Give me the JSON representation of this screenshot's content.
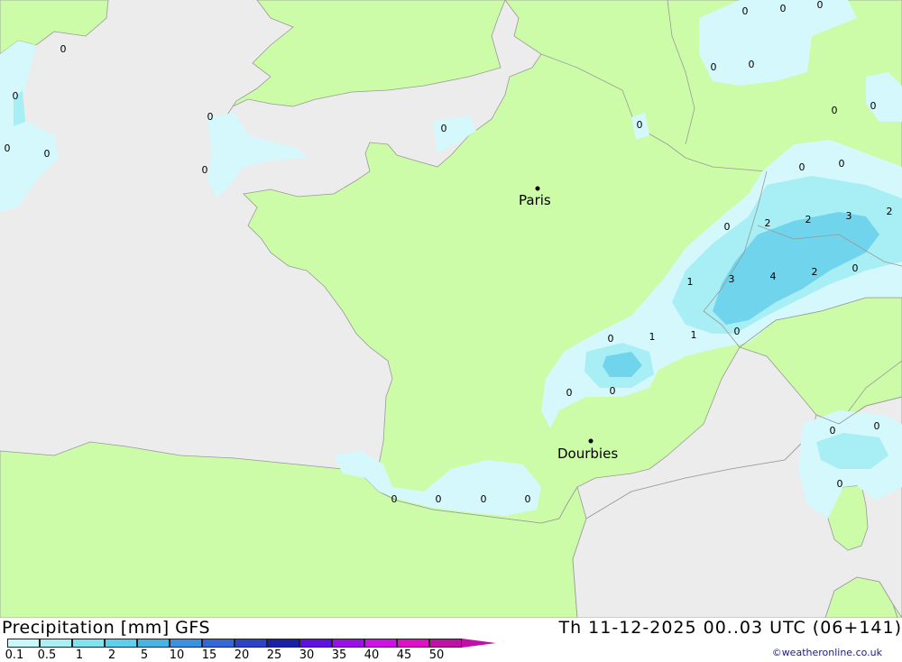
{
  "map": {
    "colors": {
      "sea": "#ececec",
      "land": "#cdfca9",
      "border": "#999999",
      "precip_light": "#d4f8fb",
      "precip_mid": "#a8eef5",
      "precip_heavy": "#6fd4ec"
    },
    "cities": [
      {
        "name": "Paris"
      },
      {
        "name": "Dourbies"
      }
    ],
    "values": [
      "0",
      "0",
      "0",
      "0",
      "0",
      "0",
      "0",
      "0",
      "0",
      "0",
      "0",
      "0",
      "0",
      "0",
      "0",
      "0",
      "0",
      "0",
      "0",
      "2",
      "2",
      "3",
      "2",
      "1",
      "3",
      "4",
      "2",
      "0",
      "0",
      "1",
      "1",
      "0",
      "0",
      "0",
      "0",
      "0",
      "0",
      "0",
      "0",
      "0",
      "0",
      "0"
    ]
  },
  "footer": {
    "title": "Precipitation [mm] GFS",
    "datetime": "Th 11-12-2025 00..03 UTC (06+141)",
    "credit": "©weatheronline.co.uk",
    "scale_labels": [
      "0.1",
      "0.5",
      "1",
      "2",
      "5",
      "10",
      "15",
      "20",
      "25",
      "30",
      "35",
      "40",
      "45",
      "50"
    ],
    "scale_colors": [
      "#c8f8fb",
      "#a8f0f6",
      "#80e4f0",
      "#5cd0ec",
      "#46b4e4",
      "#3c90e0",
      "#3468d8",
      "#2c44c8",
      "#1c20a8",
      "#6010e0",
      "#9c10e8",
      "#d010e8",
      "#e010c8",
      "#c010a8"
    ]
  }
}
